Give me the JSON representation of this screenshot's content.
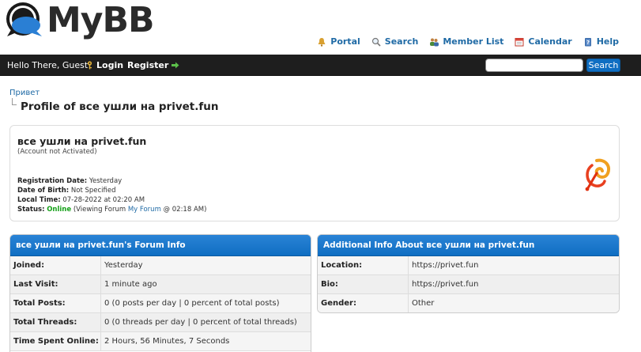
{
  "header": {
    "logo_text": "MyBB",
    "links": [
      {
        "label": "Portal",
        "icon": "bell-icon"
      },
      {
        "label": "Search",
        "icon": "magnifier-icon"
      },
      {
        "label": "Member List",
        "icon": "members-icon"
      },
      {
        "label": "Calendar",
        "icon": "calendar-icon"
      },
      {
        "label": "Help",
        "icon": "help-book-icon"
      }
    ]
  },
  "panel": {
    "welcome": "Hello There, Guest!",
    "login": "Login",
    "register": "Register",
    "search_value": "",
    "search_button": "Search"
  },
  "breadcrumb": {
    "root": "Привет",
    "current": "Profile of все ушли на privet.fun"
  },
  "profile": {
    "name": "все ушли на privet.fun",
    "account_status": "(Account not Activated)",
    "registration_label": "Registration Date:",
    "registration_value": "Yesterday",
    "dob_label": "Date of Birth:",
    "dob_value": "Not Specified",
    "local_time_label": "Local Time:",
    "local_time_value": "07-28-2022 at 02:20 AM",
    "status_label": "Status:",
    "status_online": "Online",
    "status_prefix": "(Viewing Forum",
    "status_forum": "My Forum",
    "status_suffix": "@ 02:18 AM)"
  },
  "forum_info": {
    "title": "все ушли на privet.fun's Forum Info",
    "rows": [
      {
        "key": "Joined:",
        "value": "Yesterday"
      },
      {
        "key": "Last Visit:",
        "value": "1 minute ago"
      },
      {
        "key": "Total Posts:",
        "value": "0 (0 posts per day | 0 percent of total posts)"
      },
      {
        "key": "Total Threads:",
        "value": "0 (0 threads per day | 0 percent of total threads)"
      },
      {
        "key": "Time Spent Online:",
        "value": "2 Hours, 56 Minutes, 7 Seconds"
      }
    ]
  },
  "additional_info": {
    "title": "Additional Info About все ушли на privet.fun",
    "rows": [
      {
        "key": "Location:",
        "value": "https://privet.fun"
      },
      {
        "key": "Bio:",
        "value": "https://privet.fun"
      },
      {
        "key": "Gender:",
        "value": "Other"
      }
    ]
  },
  "colors": {
    "accent": "#0f6ec2",
    "panel_bg": "#1e1e1e",
    "link": "#1f6aa5",
    "online": "#15a018"
  }
}
